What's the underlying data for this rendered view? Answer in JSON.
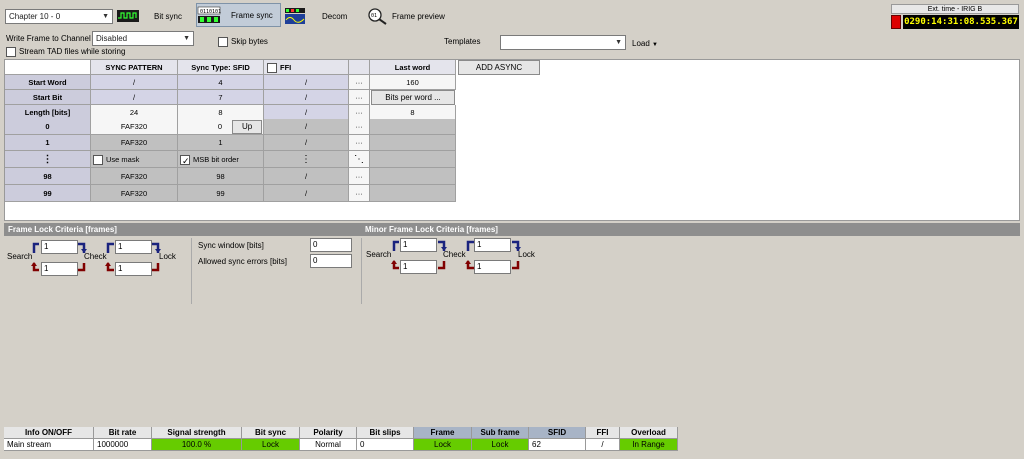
{
  "chapter_select": "Chapter 10 - 0",
  "toolbar": {
    "bit_sync": "Bit sync",
    "frame_sync": "Frame sync",
    "decom": "Decom",
    "frame_preview": "Frame preview"
  },
  "ext_time": {
    "label": "Ext. time - IRIG B",
    "value": "0290:14:31:08.535.367"
  },
  "write_frame": {
    "label": "Write Frame to Channel",
    "value": "Disabled"
  },
  "stream_tad": "Stream TAD files while storing",
  "skip_bytes": "Skip bytes",
  "templates": {
    "label": "Templates",
    "value": "",
    "load": "Load"
  },
  "grid": {
    "headers": {
      "sync_pattern": "SYNC PATTERN",
      "sync_type": "Sync Type: SFID",
      "ffi": "FFI",
      "last_word": "Last word",
      "add_async": "ADD ASYNC"
    },
    "start_word": {
      "label": "Start Word",
      "sync": "/",
      "sfid": "4",
      "ffi": "/",
      "dots": "···",
      "last": "160"
    },
    "start_bit": {
      "label": "Start Bit",
      "sync": "/",
      "sfid": "7",
      "ffi": "/",
      "dots": "···",
      "last": "Bits per word ..."
    },
    "length": {
      "label": "Length [bits]",
      "sync": "24",
      "sfid": "8",
      "ffi": "/",
      "dots": "···",
      "last": "8"
    },
    "rows": [
      {
        "idx": "0",
        "sync": "FAF320",
        "sfid": "0",
        "up": "Up",
        "ffi": "/",
        "dots": "···"
      },
      {
        "idx": "1",
        "sync": "FAF320",
        "sfid": "1",
        "ffi": "/",
        "dots": "···"
      },
      {
        "idx": "⋮",
        "use_mask": "Use mask",
        "msb": "MSB bit order",
        "ffi": "⋮",
        "dots": "⋱"
      },
      {
        "idx": "98",
        "sync": "FAF320",
        "sfid": "98",
        "ffi": "/",
        "dots": "···"
      },
      {
        "idx": "99",
        "sync": "FAF320",
        "sfid": "99",
        "ffi": "/",
        "dots": "···"
      }
    ]
  },
  "frame_lock": {
    "title": "Frame Lock Criteria [frames]",
    "search": "Search",
    "check": "Check",
    "lock": "Lock",
    "v1": "1",
    "v2": "1",
    "v3": "1",
    "v4": "1"
  },
  "sync_window": {
    "label": "Sync window [bits]",
    "value": "0"
  },
  "allowed_errors": {
    "label": "Allowed sync errors [bits]",
    "value": "0"
  },
  "minor_lock": {
    "title": "Minor Frame Lock Criteria [frames]",
    "search": "Search",
    "check": "Check",
    "lock": "Lock",
    "v1": "1",
    "v2": "1",
    "v3": "1",
    "v4": "1"
  },
  "status": {
    "headers": [
      "Info  ON/OFF",
      "Bit rate",
      "Signal strength",
      "Bit sync",
      "Polarity",
      "Bit slips",
      "Frame",
      "Sub frame",
      "SFID",
      "FFI",
      "Overload"
    ],
    "values": [
      "Main stream",
      "1000000",
      "100.0 %",
      "Lock",
      "Normal",
      "0",
      "Lock",
      "Lock",
      "62",
      "/",
      "In Range"
    ]
  },
  "colors": {
    "green": "#66cc00",
    "red": "#dd0000",
    "time_bg": "#000000",
    "time_fg": "#ffff00"
  }
}
